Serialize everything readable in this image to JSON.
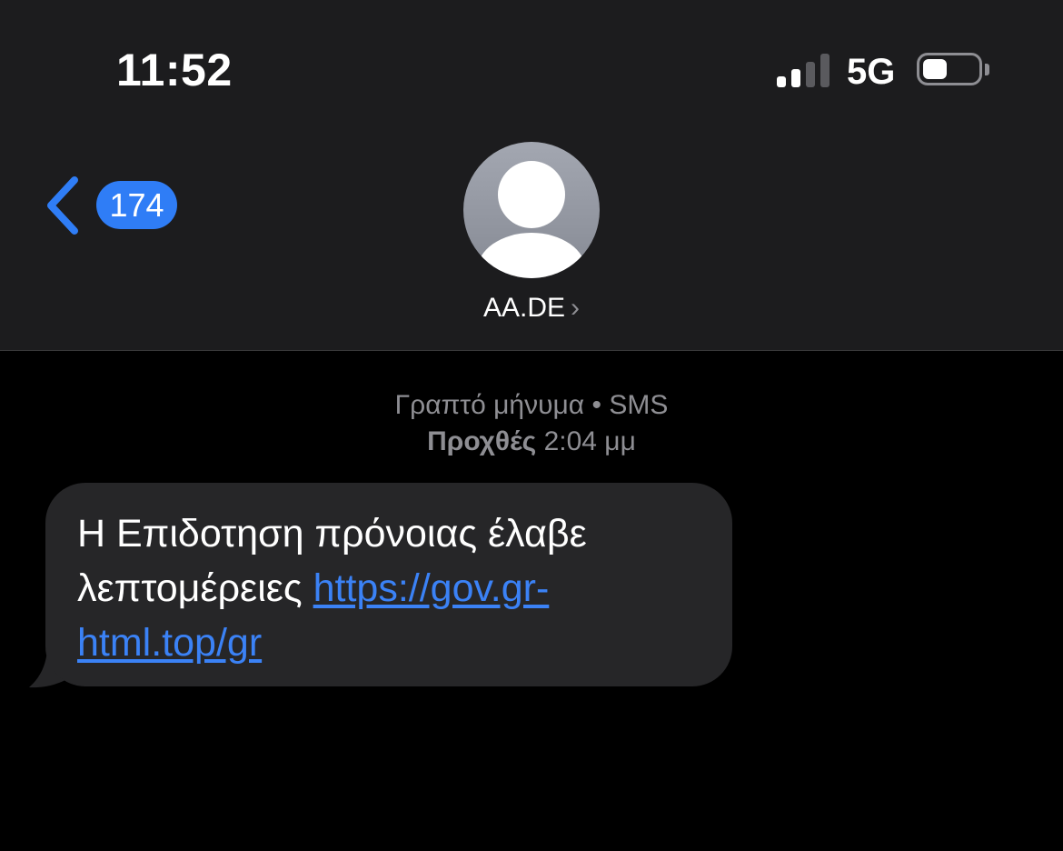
{
  "status_bar": {
    "time": "11:52",
    "network": "5G",
    "signal_bars_active": 2,
    "signal_bars_total": 4,
    "battery_level": 0.45
  },
  "nav": {
    "back_count": "174",
    "contact_name": "AA.DE",
    "contact_chevron": "›"
  },
  "conversation": {
    "service_label": "Γραπτό μήνυμα",
    "service_separator": " • ",
    "service_type": "SMS",
    "date_day": "Προχθές",
    "date_time": "2:04 μμ"
  },
  "message": {
    "text": "Η Επιδοτηση πρόνοιας έλαβε λεπτομέρειες ",
    "link": "https://gov.gr-html.top/gr"
  },
  "colors": {
    "accent": "#2f7df6",
    "link": "#3b82f6",
    "header_bg": "#1c1c1e",
    "bubble_bg": "#262628",
    "secondary_text": "#8e8e93"
  },
  "icons": {
    "back": "chevron-left-icon",
    "avatar": "person-placeholder-icon",
    "signal": "cellular-signal-icon",
    "battery": "battery-icon"
  }
}
